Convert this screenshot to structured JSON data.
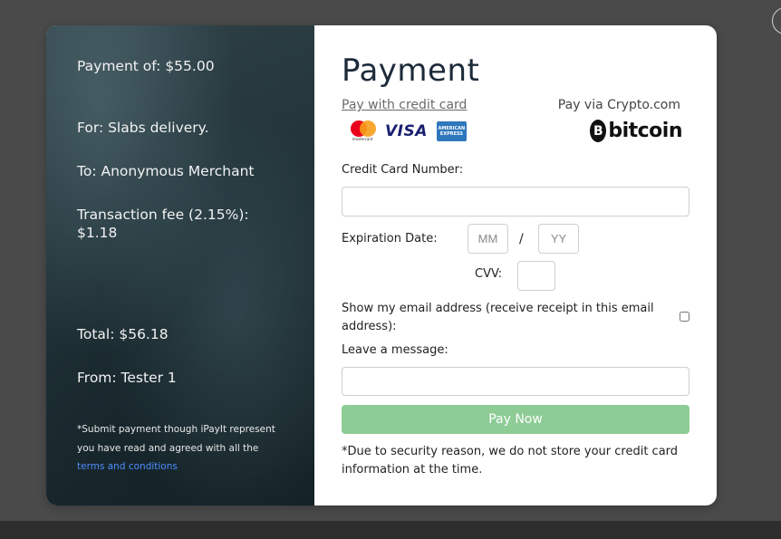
{
  "summary": {
    "payment_of": "Payment of: $55.00",
    "for": "For: Slabs delivery.",
    "to": "To: Anonymous Merchant",
    "fee": "Transaction fee (2.15%): $1.18",
    "total": "Total: $56.18",
    "from": "From: Tester 1",
    "fine_print": "*Submit payment though iPayIt represent you have read and agreed with all the",
    "terms_link": "terms and conditions"
  },
  "form": {
    "title": "Payment",
    "pay_with_card": "Pay with credit card",
    "pay_via_crypto": "Pay via Crypto.com",
    "card_brands": [
      "mastercard",
      "VISA",
      "AMERICAN EXPRESS"
    ],
    "bitcoin_symbol": "B",
    "bitcoin_label": "bitcoin",
    "card_number_label": "Credit Card Number:",
    "card_number_value": "",
    "expiry_label": "Expiration Date:",
    "expiry_month_placeholder": "MM",
    "expiry_year_placeholder": "YY",
    "expiry_separator": "/",
    "cvv_label": "CVV:",
    "show_email_label": "Show my email address (receive receipt in this email address):",
    "show_email_checked": false,
    "message_label": "Leave a message:",
    "message_value": "",
    "pay_button": "Pay Now",
    "security_note": "*Due to security reason, we do not store your credit card information at the time."
  },
  "colors": {
    "page_background": "#4a4a4a",
    "pay_button": "#8dcc95",
    "link": "#4c8dff",
    "title": "#1d2a3a"
  }
}
